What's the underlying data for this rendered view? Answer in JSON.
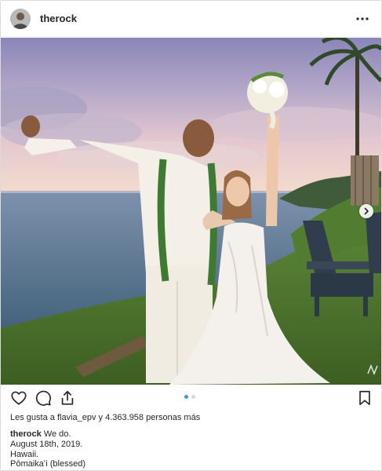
{
  "header": {
    "username": "therock",
    "avatar_icon": "profile-avatar",
    "more_icon": "more-options-icon"
  },
  "photo": {
    "alt": "Wedding photo",
    "carousel": {
      "count": 2,
      "active_index": 0
    }
  },
  "actions": {
    "like_icon": "heart-icon",
    "comment_icon": "comment-icon",
    "share_icon": "share-icon",
    "save_icon": "bookmark-icon"
  },
  "likes": {
    "prefix": "Les gusta a",
    "user": "flavia_epv",
    "middle": "y",
    "count": "4.363.958",
    "suffix": "personas más"
  },
  "caption": {
    "username": "therock",
    "text": "We do.",
    "lines": [
      "August 18th, 2019.",
      "Hawaii.",
      "Pōmaikaʻi (blessed)"
    ]
  },
  "colors": {
    "accent": "#3897f0",
    "text": "#262626",
    "border": "#dbdbdb"
  }
}
